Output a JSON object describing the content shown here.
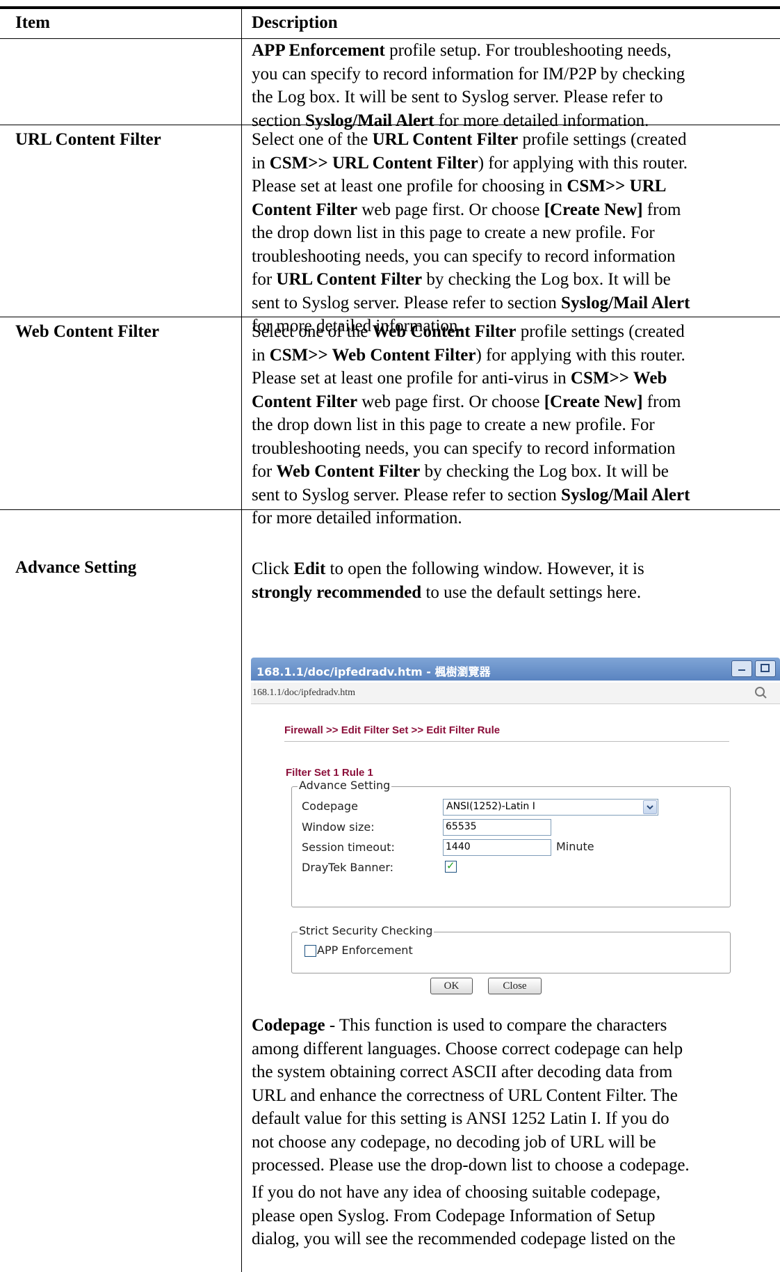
{
  "header": {
    "item": "Item",
    "description": "Description"
  },
  "rows": {
    "row0": {
      "item": "",
      "lines": [
        [
          {
            "t": "APP Enforcement",
            "b": true
          },
          {
            "t": " profile setup. For troubleshooting needs,"
          }
        ],
        [
          {
            "t": "you can specify to record information for IM/P2P by checking"
          }
        ],
        [
          {
            "t": "the Log box. It will be sent to Syslog server. Please refer to"
          }
        ],
        [
          {
            "t": "section "
          },
          {
            "t": "Syslog/Mail Alert",
            "b": true
          },
          {
            "t": " for more detailed information."
          }
        ]
      ]
    },
    "row1": {
      "item": "URL Content Filter",
      "lines": [
        [
          {
            "t": "Select one of the "
          },
          {
            "t": "URL Content Filter",
            "b": true
          },
          {
            "t": " profile settings (created"
          }
        ],
        [
          {
            "t": "in "
          },
          {
            "t": "CSM>> URL Content Filter",
            "b": true
          },
          {
            "t": ") for applying with this router."
          }
        ],
        [
          {
            "t": "Please set at least one profile for choosing in "
          },
          {
            "t": "CSM>> URL",
            "b": true
          }
        ],
        [
          {
            "t": "Content Filter",
            "b": true
          },
          {
            "t": " web page first. Or choose "
          },
          {
            "t": "[Create New]",
            "b": true
          },
          {
            "t": " from"
          }
        ],
        [
          {
            "t": "the drop down list in this page to create a new profile. For"
          }
        ],
        [
          {
            "t": "troubleshooting needs, you can specify to record information"
          }
        ],
        [
          {
            "t": "for "
          },
          {
            "t": "URL Content Filter",
            "b": true
          },
          {
            "t": " by checking the Log box. It will be"
          }
        ],
        [
          {
            "t": "sent to Syslog server. Please refer to section "
          },
          {
            "t": "Syslog/Mail Alert",
            "b": true
          }
        ],
        [
          {
            "t": "for more detailed information."
          }
        ]
      ]
    },
    "row2": {
      "item": "Web Content Filter",
      "lines": [
        [
          {
            "t": "Select one of the "
          },
          {
            "t": "Web Content Filter",
            "b": true
          },
          {
            "t": " profile settings (created"
          }
        ],
        [
          {
            "t": "in "
          },
          {
            "t": "CSM>> Web Content Filter",
            "b": true
          },
          {
            "t": ") for applying with this router."
          }
        ],
        [
          {
            "t": "Please set at least one profile for anti-virus in "
          },
          {
            "t": "CSM>> Web",
            "b": true
          }
        ],
        [
          {
            "t": "Content Filter",
            "b": true
          },
          {
            "t": " web page first. Or choose "
          },
          {
            "t": "[Create New]",
            "b": true
          },
          {
            "t": " from"
          }
        ],
        [
          {
            "t": "the drop down list in this page to create a new profile. For"
          }
        ],
        [
          {
            "t": "troubleshooting needs, you can specify to record information"
          }
        ],
        [
          {
            "t": "for "
          },
          {
            "t": "Web Content Filter",
            "b": true
          },
          {
            "t": " by checking the Log box. It will be"
          }
        ],
        [
          {
            "t": "sent to Syslog server. Please refer to section "
          },
          {
            "t": "Syslog/Mail Alert",
            "b": true
          }
        ],
        [
          {
            "t": "for more detailed information."
          }
        ]
      ]
    },
    "row3": {
      "item": "Advance Setting",
      "intro": [
        [
          {
            "t": "Click "
          },
          {
            "t": "Edit",
            "b": true
          },
          {
            "t": " to open the following window. However, it is"
          }
        ],
        [
          {
            "t": "strongly recommended",
            "b": true
          },
          {
            "t": " to use the default settings here."
          }
        ]
      ],
      "codepage_para": [
        [
          {
            "t": "Codepage",
            "b": true
          },
          {
            "t": " - This function is used to compare the characters"
          }
        ],
        [
          {
            "t": "among different languages. Choose correct codepage can help"
          }
        ],
        [
          {
            "t": "the system obtaining correct ASCII after decoding data from"
          }
        ],
        [
          {
            "t": "URL and enhance the correctness of URL Content Filter. The"
          }
        ],
        [
          {
            "t": "default value for this setting is ANSI 1252 Latin I. If you do"
          }
        ],
        [
          {
            "t": "not choose any codepage, no decoding job of URL will be"
          }
        ],
        [
          {
            "t": "processed. Please use the drop-down list to choose a codepage."
          }
        ]
      ],
      "syslog_para": [
        [
          {
            "t": "If you do not have any idea of choosing suitable codepage,"
          }
        ],
        [
          {
            "t": "please open Syslog. From Codepage Information of Setup"
          }
        ],
        [
          {
            "t": "dialog, you will see the recommended codepage listed on the"
          }
        ]
      ]
    }
  },
  "screenshot": {
    "window_title": "168.1.1/doc/ipfedradv.htm - 楓樹瀏覽器",
    "url": "168.1.1/doc/ipfedradv.htm",
    "breadcrumb": "Firewall >> Edit Filter Set >> Edit Filter Rule",
    "rule_heading": "Filter Set 1 Rule 1",
    "advance_legend": "Advance Setting",
    "codepage_label": "Codepage",
    "codepage_value": "ANSI(1252)-Latin I",
    "window_size_label": "Window size:",
    "window_size_value": "65535",
    "session_timeout_label": "Session timeout:",
    "session_timeout_value": "1440",
    "session_timeout_unit": "Minute",
    "banner_label": "DrayTek Banner:",
    "banner_checked": true,
    "strict_legend": "Strict Security Checking",
    "app_enforcement_label": "APP Enforcement",
    "app_enforcement_checked": false,
    "ok_label": "OK",
    "close_label": "Close",
    "accent_color": "#8b0f3a",
    "titlebar_color": "#6c95cc"
  }
}
